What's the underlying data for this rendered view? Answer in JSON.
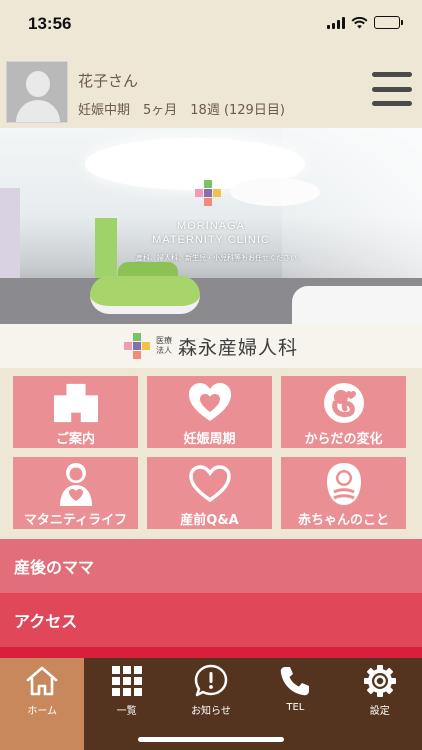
{
  "status_bar": {
    "time": "13:56",
    "icons": [
      "signal-icon",
      "wifi-icon",
      "battery-icon"
    ]
  },
  "profile": {
    "name": "花子さん",
    "pregnancy_info": "妊娠中期　5ヶ月　18週 (129日目)",
    "avatar_icon": "avatar-placeholder-icon",
    "menu_icon": "hamburger-menu-icon"
  },
  "hero": {
    "clinic_name_en_line1": "MORINAGA",
    "clinic_name_en_line2": "MATERNITY CLINIC",
    "tagline": "産科、婦人科、新生児・小児科等もお任せください。"
  },
  "brand": {
    "prefix_line1": "医療",
    "prefix_line2": "法人",
    "name": "森永産婦人科"
  },
  "tiles": [
    {
      "label": "ご案内",
      "icon": "building-icon"
    },
    {
      "label": "妊娠周期",
      "icon": "heart-icon"
    },
    {
      "label": "からだの変化",
      "icon": "fetus-icon"
    },
    {
      "label": "マタニティライフ",
      "icon": "pregnant-woman-icon"
    },
    {
      "label": "産前Q&A",
      "icon": "heart-outline-icon"
    },
    {
      "label": "赤ちゃんのこと",
      "icon": "baby-icon"
    }
  ],
  "list": [
    {
      "label": "産後のママ"
    },
    {
      "label": "アクセス"
    }
  ],
  "tabbar": [
    {
      "label": "ホーム",
      "icon": "home-icon",
      "active": true
    },
    {
      "label": "一覧",
      "icon": "grid-icon",
      "active": false
    },
    {
      "label": "お知らせ",
      "icon": "notice-icon",
      "active": false
    },
    {
      "label": "TEL",
      "icon": "phone-icon",
      "active": false
    },
    {
      "label": "設定",
      "icon": "gear-icon",
      "active": false
    }
  ],
  "colors": {
    "background": "#efe7d6",
    "tile": "#ea8f93",
    "list_postnatal": "#e16e78",
    "list_access": "#e0485a",
    "tabbar": "#55341f",
    "tab_active": "#c9885c"
  }
}
